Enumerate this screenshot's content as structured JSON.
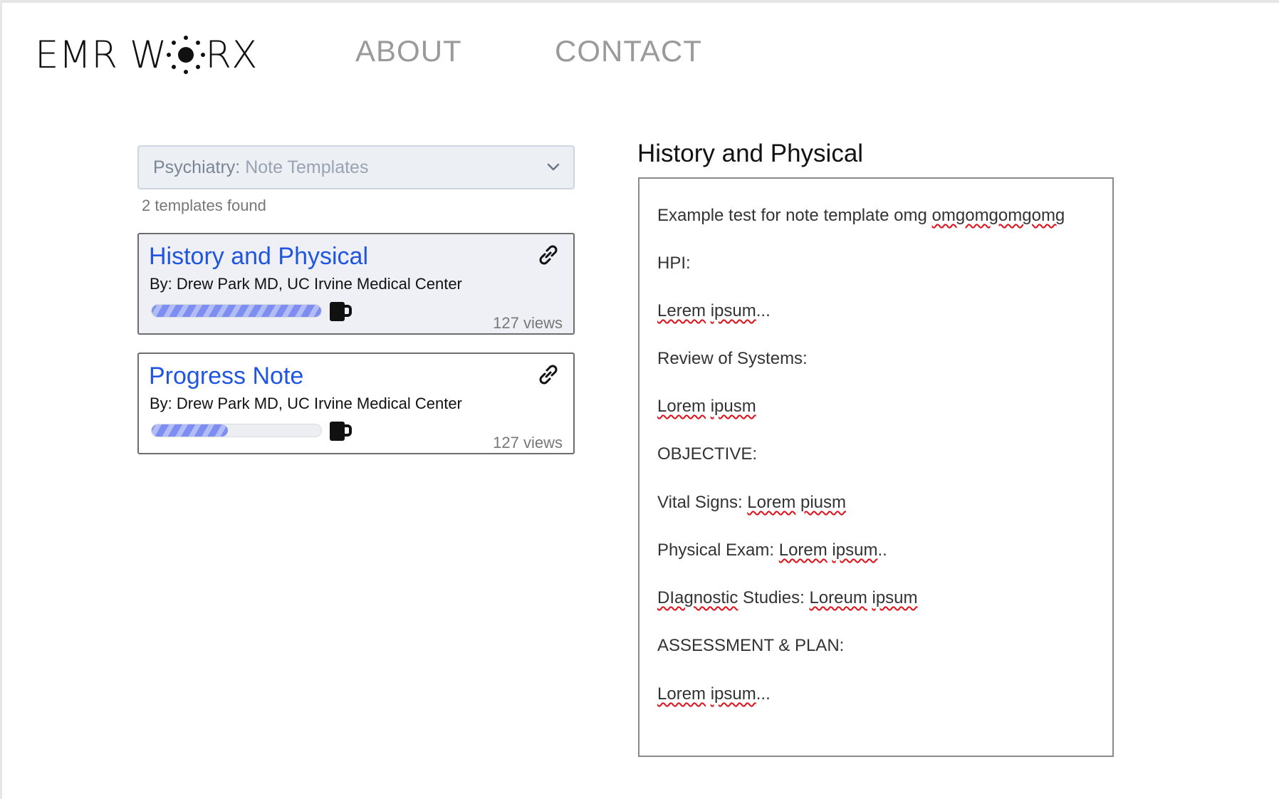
{
  "header": {
    "logo_left": "EMR W",
    "logo_icon": "sun-icon",
    "logo_right": "RX",
    "nav": {
      "about": "ABOUT",
      "contact": "CONTACT"
    }
  },
  "sidebar": {
    "dropdown": {
      "specialty": "Psychiatry:",
      "label": "Note Templates",
      "icon": "chevron-down-icon"
    },
    "results_text": "2 templates found",
    "templates": [
      {
        "title": "History and Physical",
        "author": "By: Drew Park MD, UC Irvine Medical Center",
        "views": "127 views",
        "progress": 1.0,
        "selected": true
      },
      {
        "title": "Progress Note",
        "author": "By: Drew Park MD, UC Irvine Medical Center",
        "views": "127 views",
        "progress": 0.45,
        "selected": false
      }
    ]
  },
  "preview": {
    "title": "History and Physical",
    "lines": {
      "l1a": "Example test for note template omg ",
      "l1b": "omgomgomgomg",
      "l2": "HPI:",
      "l3a": "Lerem",
      "l3b": "ipsum",
      "l3c": "...",
      "l4": "Review of Systems:",
      "l5a": "Lorem",
      "l5b": "ipusm",
      "l6": "OBJECTIVE:",
      "l7a": "Vital Signs: ",
      "l7b": "Lorem",
      "l7c": "piusm",
      "l8a": "Physical Exam: ",
      "l8b": "Lorem",
      "l8c": "ipsum",
      "l8d": "..",
      "l9a": "DIagnostic",
      "l9b": " Studies: ",
      "l9c": "Loreum",
      "l9d": "ipsum",
      "l10": "ASSESSMENT & PLAN:",
      "l11a": "Lorem",
      "l11b": "ipsum",
      "l11c": "..."
    }
  },
  "colors": {
    "accent": "#1f55e0",
    "progress": "#7d8ef0",
    "spellcheck": "#e0101a",
    "nav": "#9a9a9a"
  }
}
